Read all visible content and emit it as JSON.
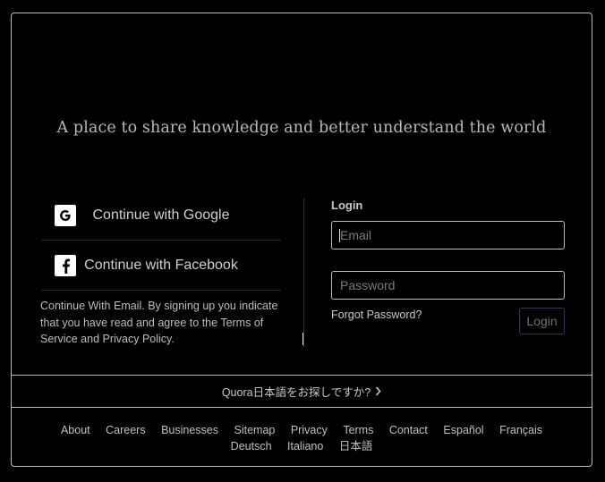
{
  "tagline": "A place to share knowledge and better understand the world",
  "sso": {
    "google_label": "Continue with Google",
    "facebook_label": "Continue with Facebook"
  },
  "email_note": {
    "link_text": "Continue With Email",
    "text1": ". By signing up you indicate that you have read and agree to the ",
    "terms_link": "Terms of Service",
    "text2": " and ",
    "privacy_link": "Privacy Policy",
    "text3": "."
  },
  "login": {
    "title": "Login",
    "email_placeholder": "Email",
    "email_value": "",
    "password_placeholder": "Password",
    "password_value": "",
    "forgot_label": "Forgot Password?",
    "submit_label": "Login"
  },
  "language_prompt": "Quora日本語をお探しですか?",
  "footer_links": [
    "About",
    "Careers",
    "Businesses",
    "Sitemap",
    "Privacy",
    "Terms",
    "Contact",
    "Español",
    "Français",
    "Deutsch",
    "Italiano",
    "日本語"
  ],
  "colors": {
    "background": "#000000",
    "border": "#bdbdbd",
    "text": "#cfcfcf",
    "login_button_border": "#2f3a55"
  },
  "icons": {
    "google": "google-g-icon",
    "facebook": "facebook-f-icon",
    "chevron": "chevron-right-icon"
  }
}
